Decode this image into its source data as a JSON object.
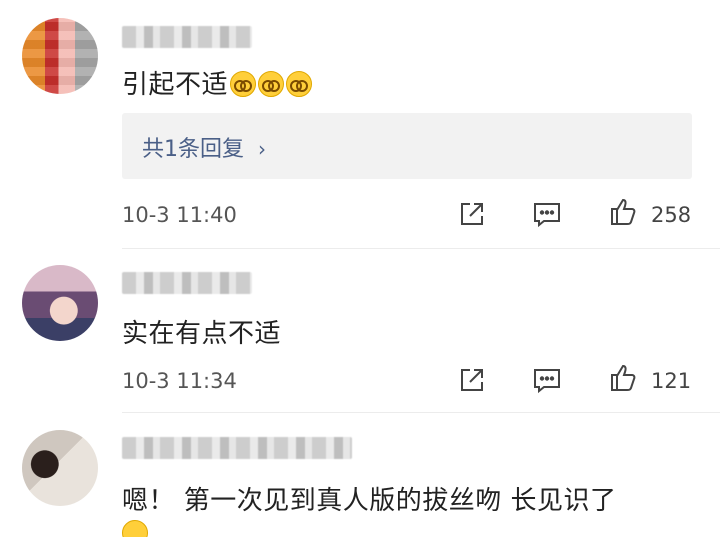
{
  "comments": [
    {
      "text": "引起不适",
      "emoji_icons": [
        "glasses-face-emoji",
        "glasses-face-emoji",
        "glasses-face-emoji"
      ],
      "reply_link": "共1条回复",
      "reply_chevron": "›",
      "time": "10-3 11:40",
      "likes": "258"
    },
    {
      "text": "实在有点不适",
      "time": "10-3 11:34",
      "likes": "121"
    },
    {
      "text": "嗯！ 第一次见到真人版的拔丝吻 长见识了",
      "emoji_icons": [
        "smile-emoji"
      ]
    }
  ],
  "icons": {
    "share": "share-icon",
    "comment": "comment-icon",
    "like": "thumbs-up-icon"
  },
  "colors": {
    "reply_link": "#4a5f87",
    "text": "#222222",
    "meta": "#555555"
  }
}
